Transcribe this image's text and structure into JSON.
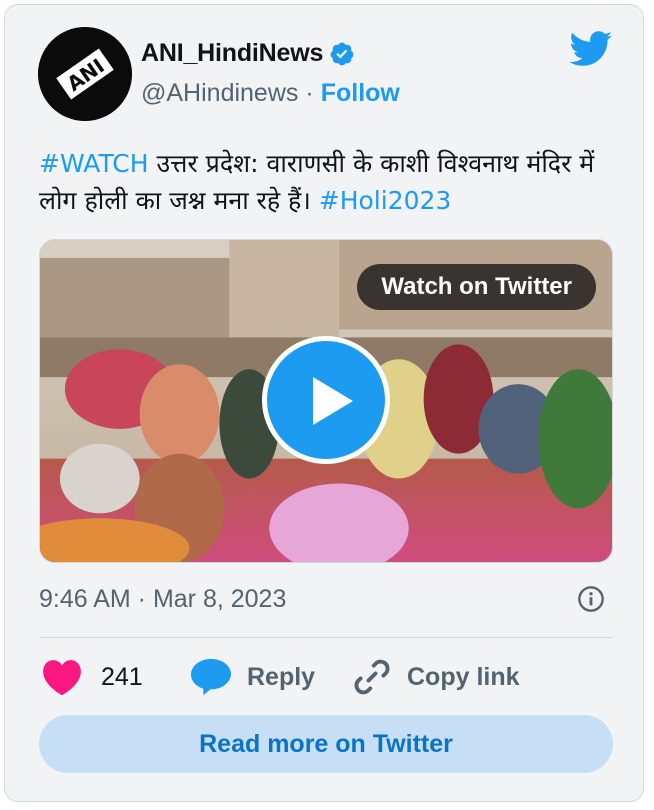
{
  "author": {
    "name": "ANI_HindiNews",
    "handle": "@AHindinews",
    "follow_label": "Follow",
    "avatar_logo_text": "ANI",
    "verified": true
  },
  "tweet": {
    "hashtag_1": "#WATCH",
    "text": "  उत्तर प्रदेश: वाराणसी के काशी विश्वनाथ मंदिर में लोग होली का जश्न मना रहे हैं। ",
    "hashtag_2": "#Holi2023"
  },
  "media": {
    "watch_label": "Watch on Twitter"
  },
  "meta": {
    "timestamp": "9:46 AM · Mar 8, 2023"
  },
  "actions": {
    "likes": "241",
    "reply_label": "Reply",
    "copy_label": "Copy link"
  },
  "footer": {
    "read_more_label": "Read more on Twitter"
  },
  "colors": {
    "accent": "#1d9bf0",
    "like": "#f91880",
    "card_bg": "#f1f3f5",
    "read_more_bg": "#c6dff4"
  }
}
